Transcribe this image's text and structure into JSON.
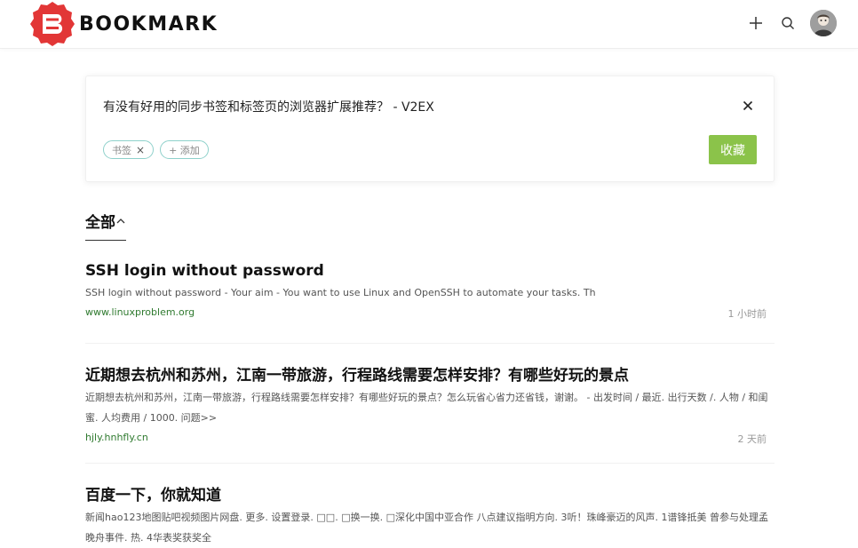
{
  "header": {
    "brand": "BOOKMARK",
    "brand_color": "#e23636",
    "icons": [
      "plus-icon",
      "search-icon",
      "avatar"
    ]
  },
  "card": {
    "title": "有没有好用的同步书签和标签页的浏览器扩展推荐？ - V2EX",
    "tags": [
      {
        "label": "书签",
        "removable": true
      }
    ],
    "add_tag_label": "+ 添加",
    "save_label": "收藏",
    "save_color": "#8bc34a",
    "tag_border_color": "#8fd1cb"
  },
  "section": {
    "tab_label": "全部"
  },
  "items": [
    {
      "title": "SSH login without password",
      "desc": "SSH login without password - Your aim - You want to use Linux and OpenSSH to automate your tasks. Th",
      "host": "www.linuxproblem.org",
      "time": "1 小时前"
    },
    {
      "title": "近期想去杭州和苏州，江南一带旅游，行程路线需要怎样安排？有哪些好玩的景点",
      "desc": "近期想去杭州和苏州，江南一带旅游，行程路线需要怎样安排？有哪些好玩的景点？怎么玩省心省力还省钱，谢谢。 - 出发时间 / 最近. 出行天数 /. 人物 / 和闺蜜. 人均费用 / 1000. 问题>>",
      "host": "hjly.hnhfly.cn",
      "time": "2 天前"
    },
    {
      "title": "百度一下，你就知道",
      "desc": "新闻hao123地图贴吧视频图片网盘. 更多. 设置登录. □□. □换一换. □深化中国中亚合作 八点建议指明方向. 3听！珠峰豪迈的风声. 1谱锋抵美 曾参与处理孟晚舟事件. 热. 4华表奖获奖全",
      "host": "",
      "time": ""
    }
  ]
}
